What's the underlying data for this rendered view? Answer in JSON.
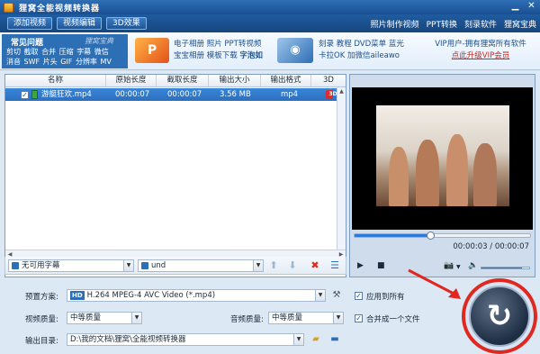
{
  "app": {
    "title": "狸窝全能视频转换器"
  },
  "toolbar": {
    "add_video": "添加视频",
    "edit_video": "视频编辑",
    "effect_3d": "3D效果",
    "links": [
      "照片制作视频",
      "PPT转换",
      "刻录软件",
      "狸窝宝典"
    ]
  },
  "banner": {
    "faq_title": "常见问题",
    "faq_sub": "狸窝宝典",
    "faq_links": [
      "剪切",
      "截取",
      "合并",
      "压缩",
      "字幕",
      "微信",
      "消音",
      "SWF",
      "片头",
      "GIF",
      "分辨率",
      "MV"
    ],
    "ad1_icon": "P",
    "ad1_line1": "电子相册  照片  PPT转视频",
    "ad1_line2_a": "宝宝相册  模板下载  ",
    "ad1_line2_b": "字泡如",
    "ad2_line1": "刻录  教程  DVD菜单  蓝光",
    "ad2_line2": "卡拉OK  加微信aileawo",
    "ad3_line1": "VIP用户-拥有狸窝所有软件",
    "ad3_line2": "点此升级VIP会员"
  },
  "file_list": {
    "columns": [
      "名称",
      "原始长度",
      "截取长度",
      "输出大小",
      "输出格式",
      "3D"
    ],
    "rows": [
      {
        "checked": "✓",
        "name": "游艇狂欢.mp4",
        "original": "00:00:07",
        "cut": "00:00:07",
        "size": "3.56 MB",
        "format": "mp4",
        "d3": "3D"
      }
    ]
  },
  "list_bottom": {
    "subtitle": "无可用字幕",
    "audio": "und"
  },
  "preview": {
    "time": "00:00:03 / 00:00:07",
    "progress": 0.43,
    "volume": 0.85
  },
  "settings": {
    "preset_label": "预置方案:",
    "preset_badge": "HD",
    "preset_value": "H.264 MPEG-4 AVC Video (*.mp4)",
    "apply_all": "应用到所有",
    "merge": "合并成一个文件",
    "video_quality_label": "视频质量:",
    "video_quality": "中等质量",
    "audio_quality_label": "音频质量:",
    "audio_quality": "中等质量",
    "output_label": "输出目录:",
    "output_path": "D:\\我的文档\\狸窝\\全能视频转换器"
  },
  "icons": {
    "convert": "refresh-arrow-icon",
    "highlight_color": "#e02820"
  }
}
